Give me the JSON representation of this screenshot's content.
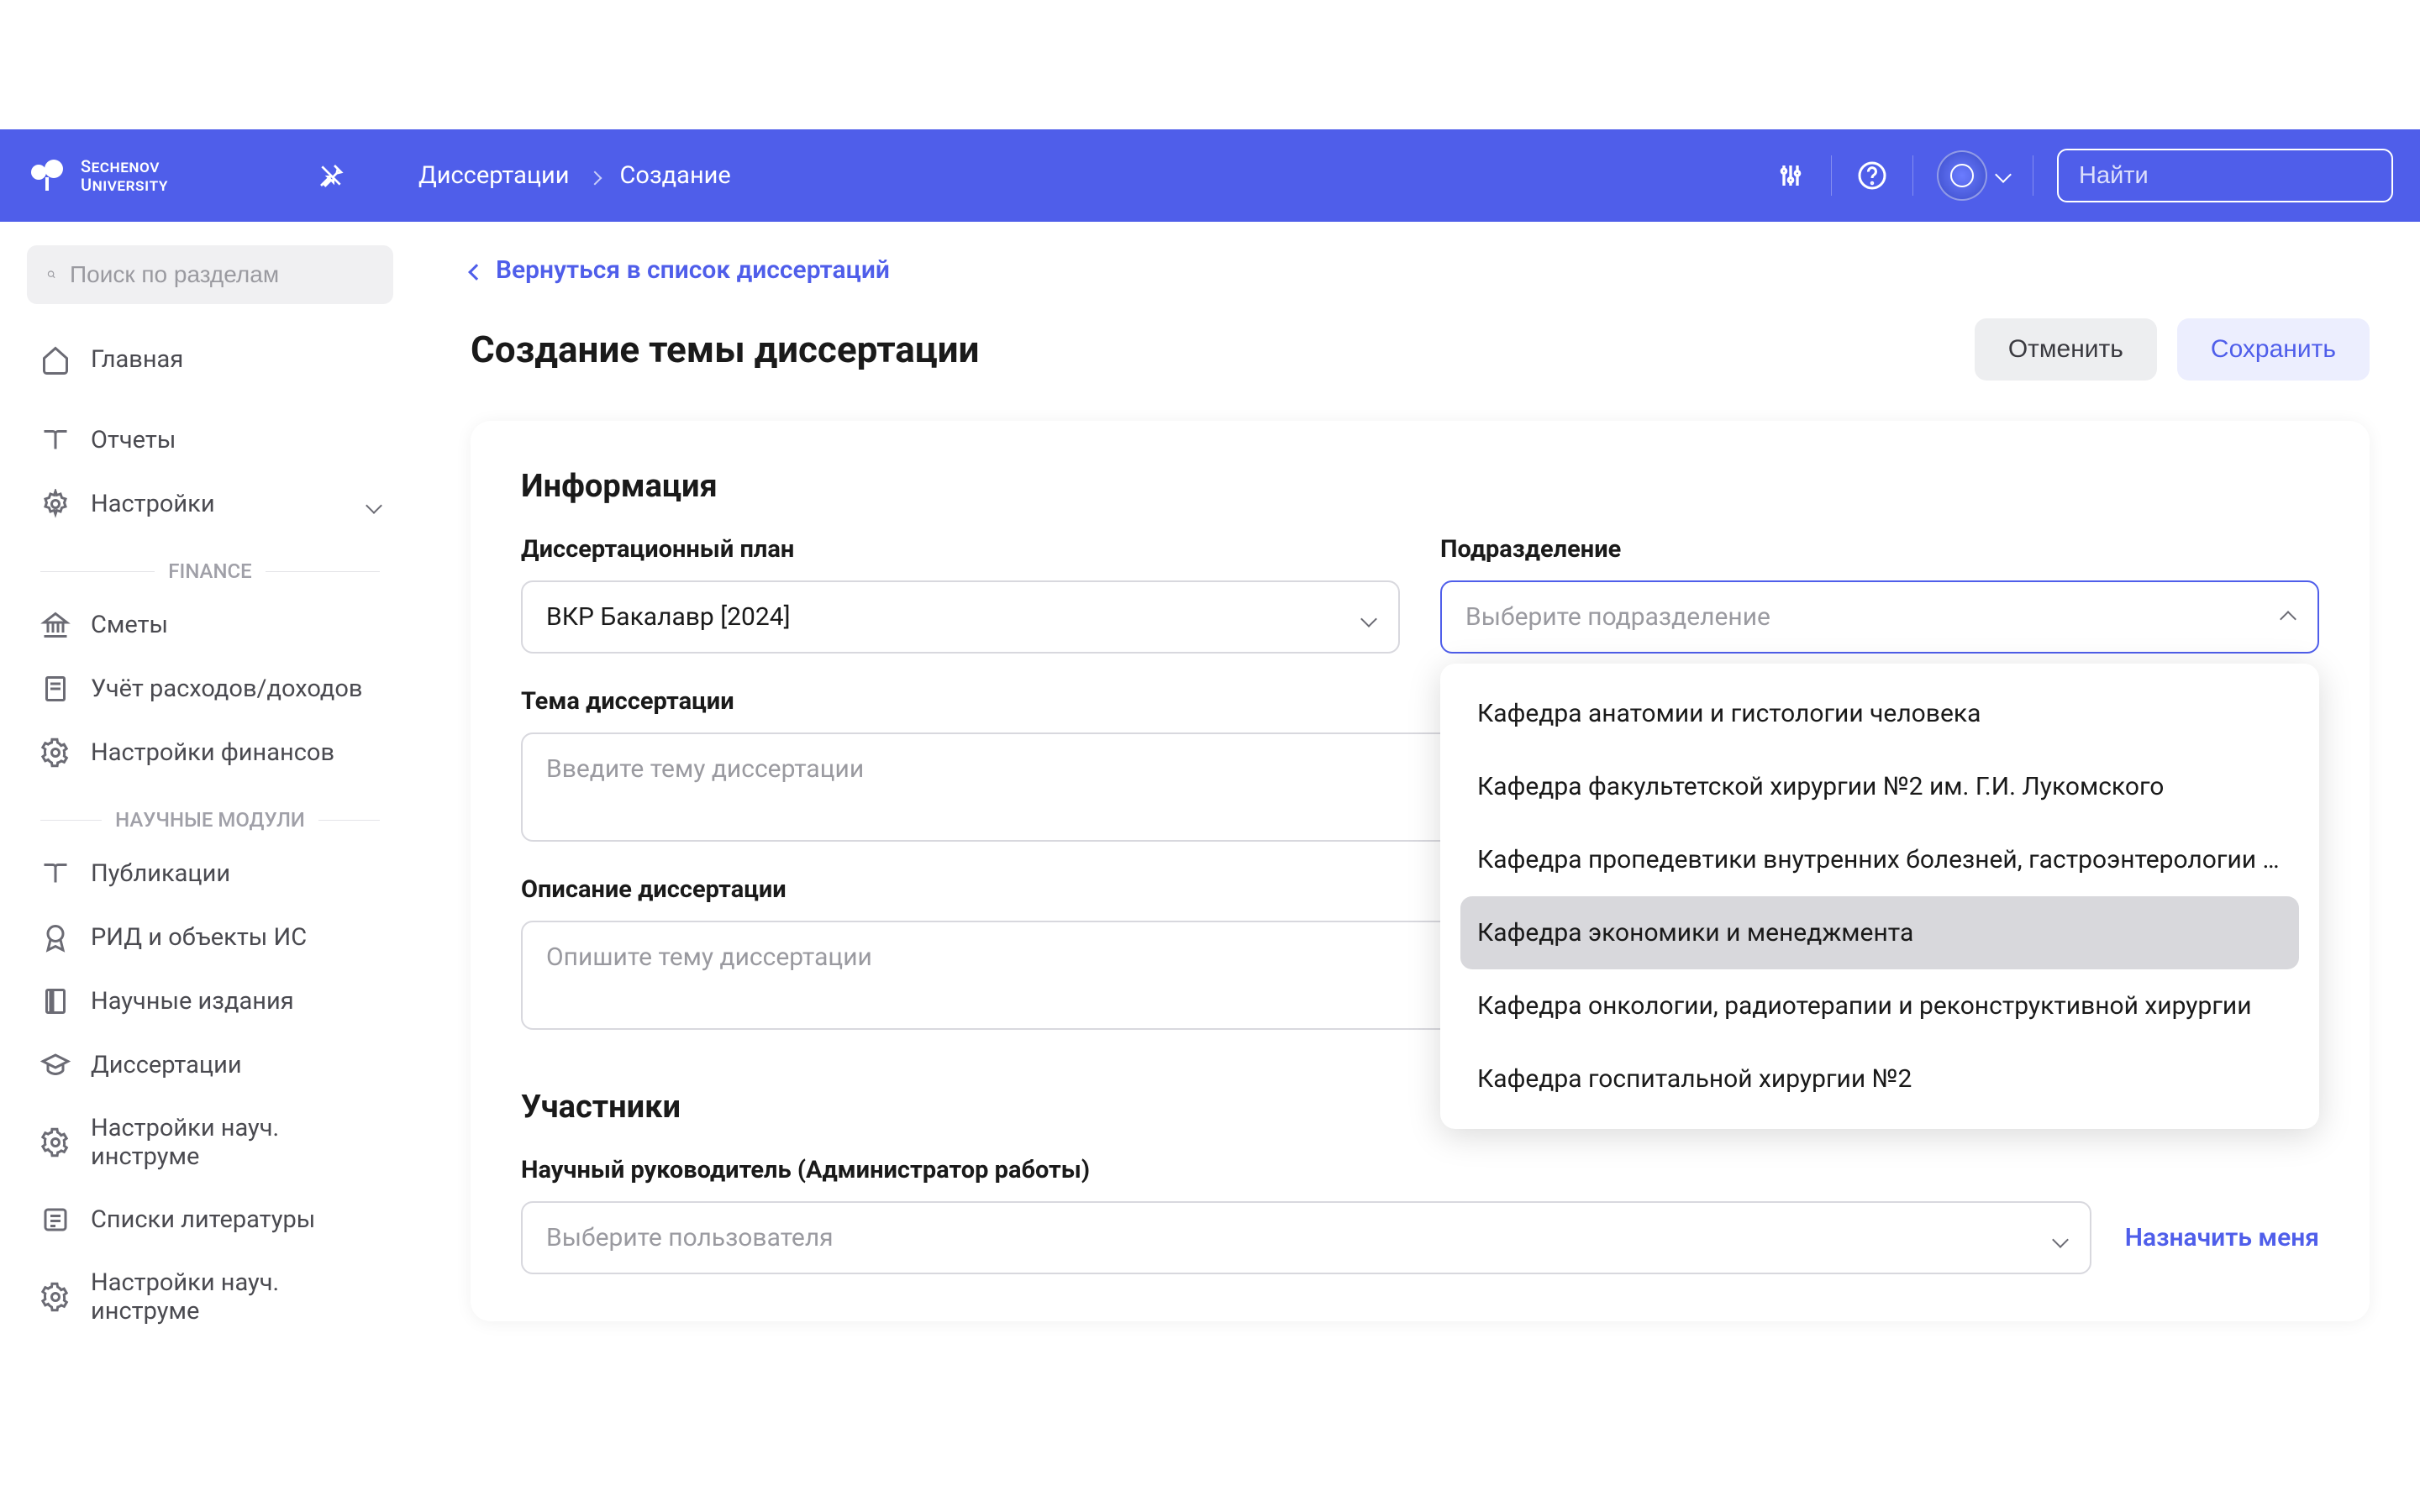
{
  "header": {
    "logo_text": "Sechenov\nUniversity",
    "breadcrumb": [
      "Диссертации",
      "Создание"
    ],
    "search_placeholder": "Найти"
  },
  "sidebar": {
    "search_placeholder": "Поиск по разделам",
    "items_top": [
      {
        "label": "Главная",
        "icon": "home"
      },
      {
        "label": "Отчеты",
        "icon": "book"
      },
      {
        "label": "Настройки",
        "icon": "gear",
        "chevron": true
      }
    ],
    "section_finance": "FINANCE",
    "items_finance": [
      {
        "label": "Сметы",
        "icon": "bank"
      },
      {
        "label": "Учёт расходов/доходов",
        "icon": "receipt"
      },
      {
        "label": "Настройки финансов",
        "icon": "gear"
      }
    ],
    "section_science": "НАУЧНЫЕ МОДУЛИ",
    "items_science": [
      {
        "label": "Публикации",
        "icon": "book"
      },
      {
        "label": "РИД и объекты ИС",
        "icon": "award"
      },
      {
        "label": "Научные издания",
        "icon": "journal"
      },
      {
        "label": "Диссертации",
        "icon": "cap"
      },
      {
        "label": "Настройки науч. инструме",
        "icon": "gear"
      },
      {
        "label": "Списки литературы",
        "icon": "list"
      },
      {
        "label": "Настройки науч. инструме",
        "icon": "gear"
      }
    ]
  },
  "main": {
    "back_label": "Вернуться в список диссертаций",
    "page_title": "Создание темы диссертации",
    "cancel_label": "Отменить",
    "save_label": "Сохранить",
    "info_title": "Информация",
    "plan": {
      "label": "Диссертационный план",
      "value": "ВКР Бакалавр [2024]"
    },
    "dept": {
      "label": "Подразделение",
      "placeholder": "Выберите подразделение",
      "options": [
        "Кафедра анатомии и гистологии человека",
        "Кафедра факультетской хирургии №2 им. Г.И. Лукомского",
        "Кафедра пропедевтики внутренних болезней, гастроэнтерологии и гепато...",
        "Кафедра экономики и менеджмента",
        "Кафедра онкологии, радиотерапии и реконструктивной хирургии",
        "Кафедра госпитальной хирургии №2"
      ],
      "hovered_index": 3
    },
    "topic": {
      "label": "Тема диссертации",
      "placeholder": "Введите тему диссертации"
    },
    "desc": {
      "label": "Описание диссертации",
      "placeholder": "Опишите тему диссертации"
    },
    "participants": {
      "title": "Участники",
      "supervisor_label": "Научный руководитель (Администратор работы)",
      "supervisor_placeholder": "Выберите пользователя",
      "assign_me": "Назначить меня"
    }
  }
}
